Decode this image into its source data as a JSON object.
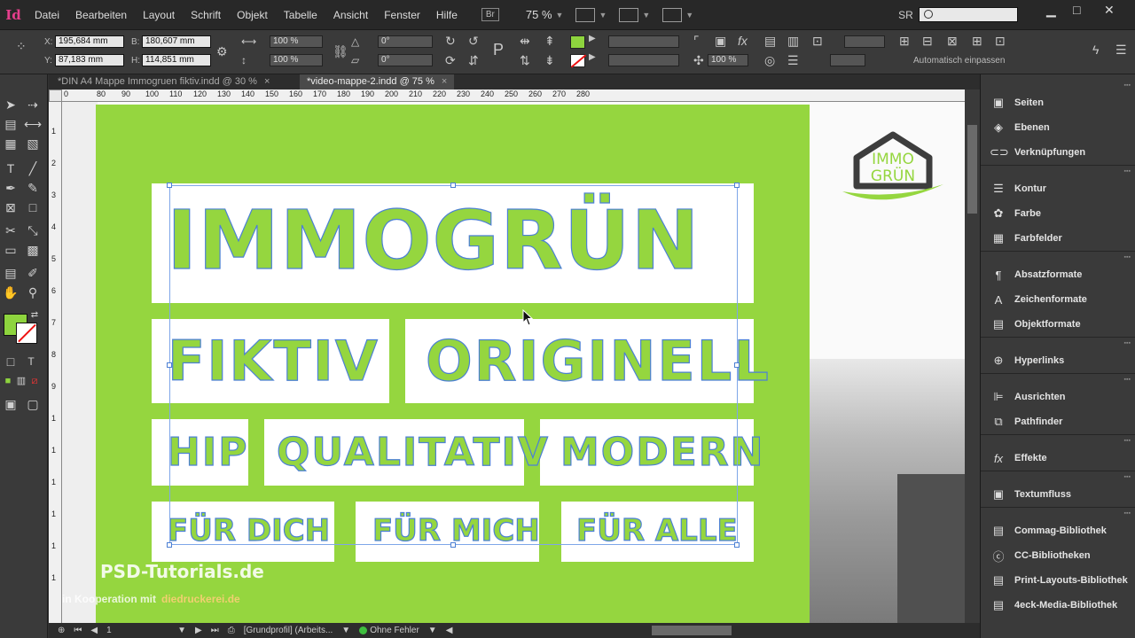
{
  "app": {
    "logo_text": "Id"
  },
  "menu": {
    "items": [
      "Datei",
      "Bearbeiten",
      "Layout",
      "Schrift",
      "Objekt",
      "Tabelle",
      "Ansicht",
      "Fenster",
      "Hilfe"
    ],
    "bridge": "Br",
    "zoom": "75 %",
    "workspace": "SR"
  },
  "control": {
    "x_label": "X:",
    "x_value": "195,684 mm",
    "y_label": "Y:",
    "y_value": "87,183 mm",
    "w_label": "B:",
    "w_value": "180,607 mm",
    "h_label": "H:",
    "h_value": "114,851 mm",
    "scale_x": "100 %",
    "scale_y": "100 %",
    "rotate": "0°",
    "shear": "0°",
    "opacity": "100 %",
    "autofit": "Automatisch einpassen"
  },
  "tabs": [
    {
      "label": "*DIN A4 Mappe Immogruen fiktiv.indd @ 30 %"
    },
    {
      "label": "*video-mappe-2.indd @ 75 %"
    }
  ],
  "ruler_h": [
    "0",
    "80",
    "90",
    "100",
    "110",
    "120",
    "130",
    "140",
    "150",
    "160",
    "170",
    "180",
    "190",
    "200",
    "210",
    "220",
    "230",
    "240",
    "250",
    "260",
    "270",
    "280"
  ],
  "ruler_v": [
    "1",
    "2",
    "3",
    "4",
    "5",
    "6",
    "7",
    "8",
    "9",
    "1",
    "1",
    "1",
    "1",
    "1",
    "1"
  ],
  "doc": {
    "line1": "IMMOGRÜN",
    "row2": [
      "FIKTIV",
      "ORIGINELL"
    ],
    "row3": [
      "HIP",
      "QUALITATIV",
      "MODERN"
    ],
    "row4": [
      "FÜR DICH",
      "FÜR MICH",
      "FÜR ALLE"
    ],
    "logo_top": "IMMO",
    "logo_bottom": "GRÜN",
    "watermark": "PSD-Tutorials.de",
    "watermark_sub": "in Kooperation mit",
    "watermark_brand": "diedruckerei.de"
  },
  "status": {
    "page": "1",
    "profile": "[Grundprofil] (Arbeits...",
    "errors": "Ohne Fehler"
  },
  "panels": [
    {
      "items": [
        {
          "label": "Seiten",
          "icon": "pages-icon"
        },
        {
          "label": "Ebenen",
          "icon": "layers-icon"
        },
        {
          "label": "Verknüpfungen",
          "icon": "links-icon"
        }
      ]
    },
    {
      "items": [
        {
          "label": "Kontur",
          "icon": "stroke-icon"
        },
        {
          "label": "Farbe",
          "icon": "color-icon"
        },
        {
          "label": "Farbfelder",
          "icon": "swatches-icon"
        }
      ]
    },
    {
      "items": [
        {
          "label": "Absatzformate",
          "icon": "paragraph-styles-icon"
        },
        {
          "label": "Zeichenformate",
          "icon": "character-styles-icon"
        },
        {
          "label": "Objektformate",
          "icon": "object-styles-icon"
        }
      ]
    },
    {
      "items": [
        {
          "label": "Hyperlinks",
          "icon": "hyperlinks-icon"
        }
      ]
    },
    {
      "items": [
        {
          "label": "Ausrichten",
          "icon": "align-icon"
        },
        {
          "label": "Pathfinder",
          "icon": "pathfinder-icon"
        }
      ]
    },
    {
      "items": [
        {
          "label": "Effekte",
          "icon": "effects-icon"
        }
      ]
    },
    {
      "items": [
        {
          "label": "Textumfluss",
          "icon": "text-wrap-icon"
        }
      ]
    },
    {
      "items": [
        {
          "label": "Commag-Bibliothek",
          "icon": "library-icon"
        },
        {
          "label": "CC-Bibliotheken",
          "icon": "cc-libraries-icon"
        },
        {
          "label": "Print-Layouts-Bibliothek",
          "icon": "library-icon"
        },
        {
          "label": "4eck-Media-Bibliothek",
          "icon": "library-icon"
        }
      ]
    }
  ],
  "colors": {
    "brand_green": "#95d63f",
    "selection_blue": "#4c80d4",
    "logo_gray": "#3d3d3d"
  }
}
